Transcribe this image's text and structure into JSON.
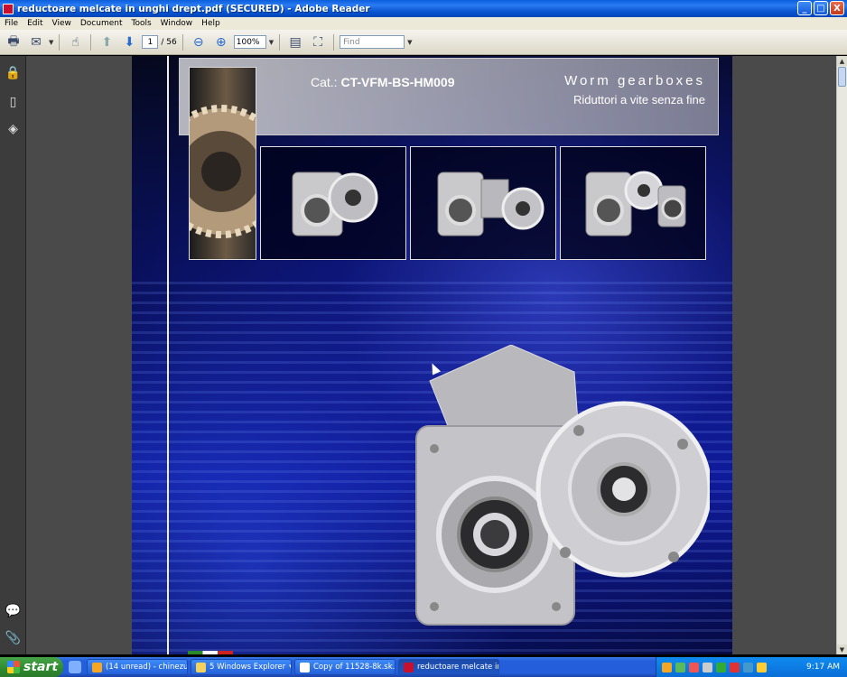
{
  "window": {
    "title": "reductoare melcate in unghi drept.pdf (SECURED) - Adobe Reader",
    "controls": [
      "_",
      "□",
      "X"
    ]
  },
  "menu": [
    "File",
    "Edit",
    "View",
    "Document",
    "Tools",
    "Window",
    "Help"
  ],
  "toolbar": {
    "page_current": "1",
    "page_total": "/ 56",
    "zoom": "100%",
    "find_placeholder": "Find"
  },
  "document": {
    "catalog_prefix": "Cat.:",
    "catalog_code": "CT-VFM-BS-HM009",
    "title": "Worm gearboxes",
    "subtitle": "Riduttori a vite senza fine"
  },
  "taskbar": {
    "start": "start",
    "tasks": [
      "(14 unread) - chinezu...",
      "5 Windows Explorer",
      "Copy of 11528-8k.sk...",
      "reductoare melcate in..."
    ],
    "clock": "9:17 AM"
  },
  "colors": {
    "titlebar": "#0a5ddc",
    "taskbar": "#245edb",
    "page_bg": "#0a1160"
  }
}
